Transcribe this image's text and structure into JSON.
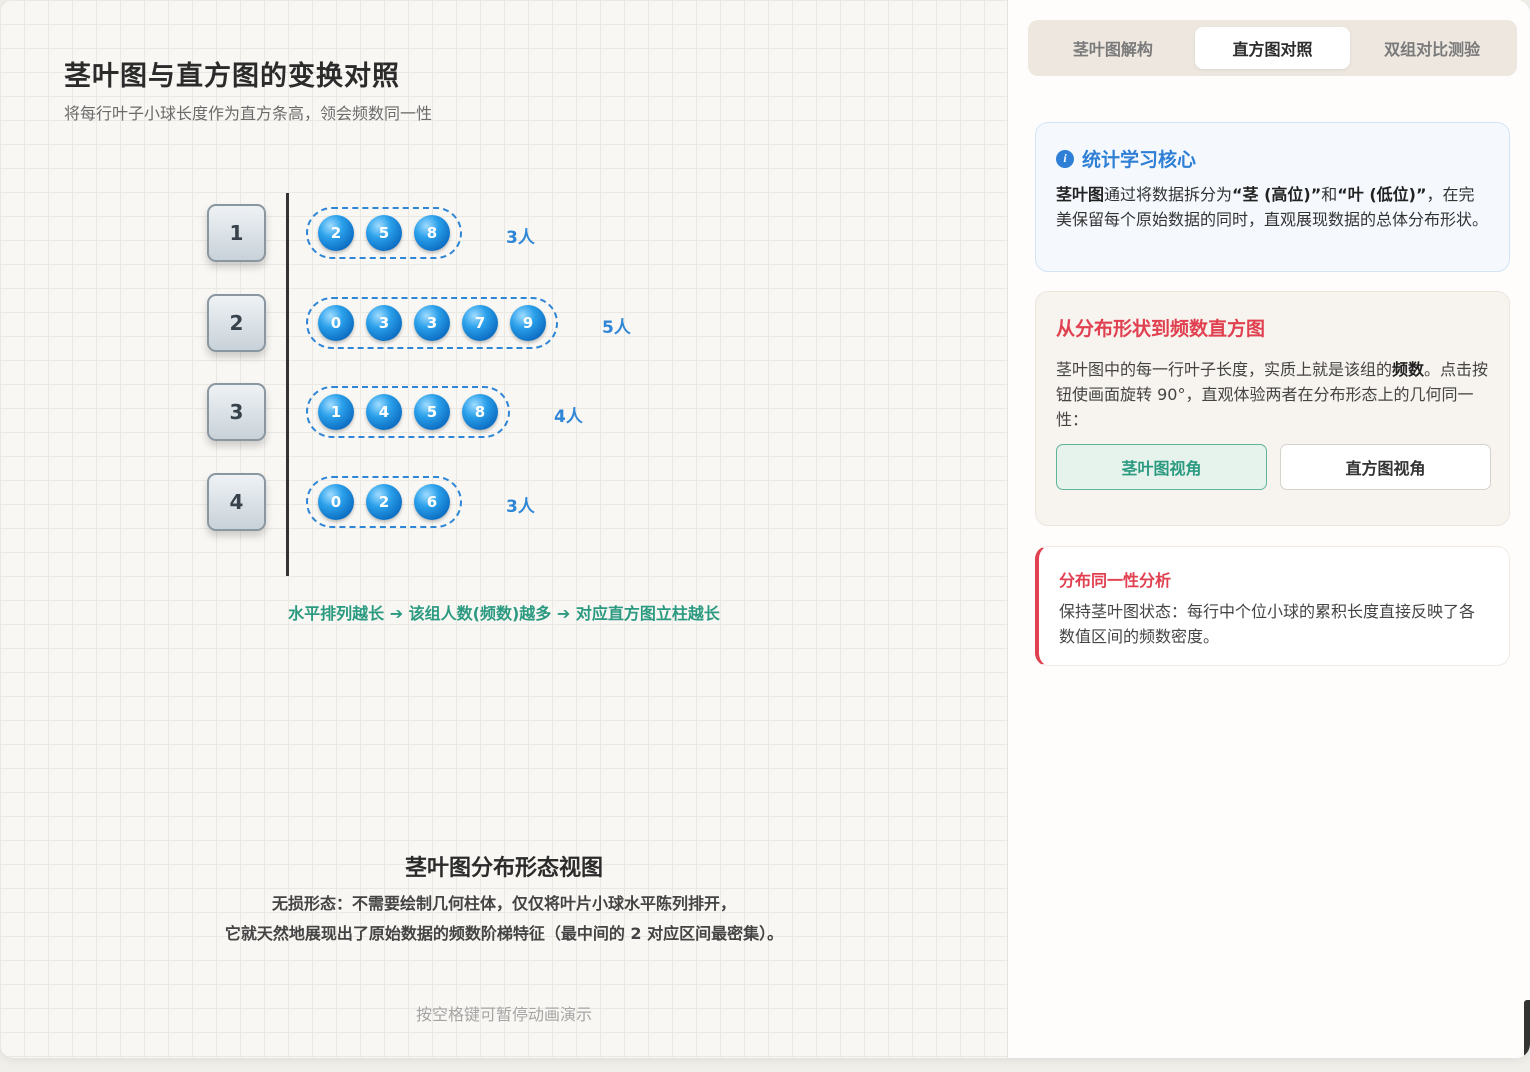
{
  "canvas": {
    "title": "茎叶图与直方图的变换对照",
    "subtitle": "将每行叶子小球长度作为直方条高，领会频数同一性",
    "rows": [
      {
        "stem": "1",
        "leaves": [
          "2",
          "5",
          "8"
        ],
        "count": "3人"
      },
      {
        "stem": "2",
        "leaves": [
          "0",
          "3",
          "3",
          "7",
          "9"
        ],
        "count": "5人"
      },
      {
        "stem": "3",
        "leaves": [
          "1",
          "4",
          "5",
          "8"
        ],
        "count": "4人"
      },
      {
        "stem": "4",
        "leaves": [
          "0",
          "2",
          "6"
        ],
        "count": "3人"
      }
    ],
    "caption": "水平排列越长 ➔ 该组人数(频数)越多 ➔ 对应直方图立柱越长",
    "view_title": "茎叶图分布形态视图",
    "view_line1": "无损形态：不需要绘制几何柱体，仅仅将叶片小球水平陈列排开，",
    "view_line2": "它就天然地展现出了原始数据的频数阶梯特征（最中间的 2 对应区间最密集）。",
    "hint": "按空格键可暂停动画演示"
  },
  "panel": {
    "tabs": [
      "茎叶图解构",
      "直方图对照",
      "双组对比测验"
    ],
    "active_tab": "直方图对照",
    "info": {
      "icon": "i",
      "title": "统计学习核心",
      "body_bold1": "茎叶图",
      "body_1": "通过将数据拆分为",
      "body_bold2": "“茎 (高位)”",
      "body_2": "和",
      "body_bold3": "“叶 (低位)”",
      "body_3": "，在完美保留每个原始数据的同时，直观展现数据的总体分布形状。"
    },
    "hist": {
      "title": "从分布形状到频数直方图",
      "body_1": "茎叶图中的每一行叶子长度，实质上就是该组的",
      "body_bold": "频数",
      "body_2": "。点击按钮使画面旋转 90°，直观体验两者在分布形态上的几何同一性：",
      "btn_stem": "茎叶图视角",
      "btn_hist": "直方图视角"
    },
    "analysis": {
      "title": "分布同一性分析",
      "body": "保持茎叶图状态：每行中个位小球的累积长度直接反映了各数值区间的频数密度。"
    },
    "colors": {
      "accent_blue": "#2f7fd6",
      "accent_red": "#e04050",
      "accent_green": "#2b9a80"
    }
  }
}
